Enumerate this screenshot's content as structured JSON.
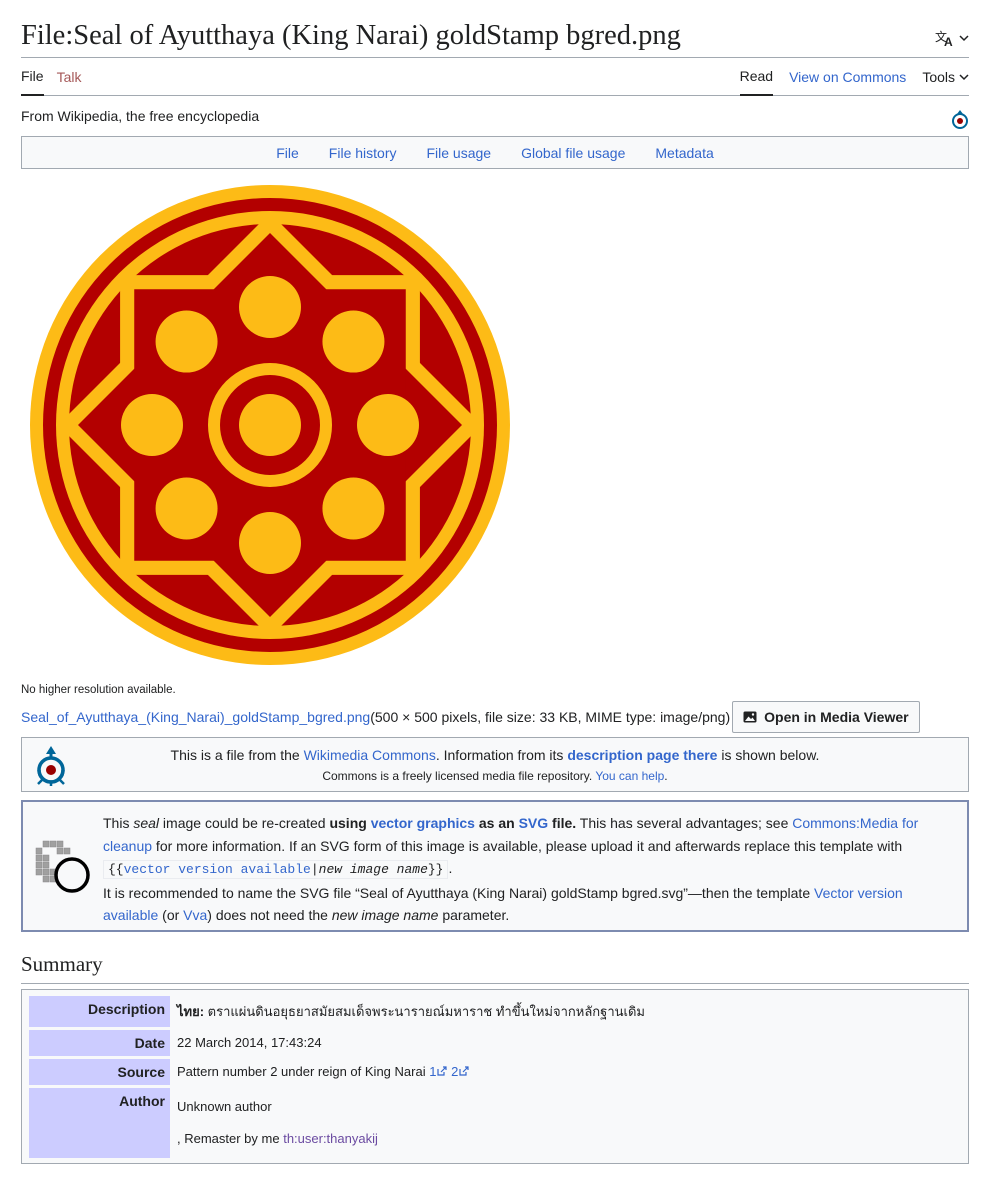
{
  "header": {
    "title": "File:Seal of Ayutthaya (King Narai) goldStamp bgred.png",
    "language_icon": "translate-icon"
  },
  "tabs": {
    "file": "File",
    "talk": "Talk",
    "read": "Read",
    "view_on_commons": "View on Commons",
    "tools": "Tools"
  },
  "tagline": "From Wikipedia, the free encyclopedia",
  "file_toc": [
    "File",
    "File history",
    "File usage",
    "Global file usage",
    "Metadata"
  ],
  "image": {
    "colors": {
      "gold": "#fdbb16",
      "red": "#b30000"
    },
    "no_higher": "No higher resolution available.",
    "file_link": "Seal_of_Ayutthaya_(King_Narai)_goldStamp_bgred.png",
    "file_meta": " (500 × 500 pixels, file size: 33 KB, MIME type: image/png)",
    "media_viewer_button": "Open in Media Viewer"
  },
  "commons_notice": {
    "text1": "This is a file from the ",
    "link1": "Wikimedia Commons",
    "text2": ". Information from its ",
    "link2": "description page there",
    "text3": " is shown below.",
    "line2_text": "Commons is a freely licensed media file repository. ",
    "line2_link": "You can help"
  },
  "vector_notice": {
    "p1": "This ",
    "p1_em": "seal",
    "p2": " image could be re-created ",
    "p2_bold": "using",
    "link_vector": "vector graphics",
    "p3_bold": " as an ",
    "link_svg": "SVG",
    "p4_bold": " file.",
    "p5": " This has several advantages; see ",
    "link_cleanup": "Commons:Media for cleanup",
    "p6": " for more information. If an SVG form of this image is available, please upload it and afterwards replace this template with ",
    "code_open": "{{",
    "code_link": "vector version available",
    "code_pipe": "|",
    "code_em": "new image name",
    "code_close": "}}",
    "p7": ".",
    "p8": "It is recommended to name the SVG file “Seal of Ayutthaya (King Narai) goldStamp bgred.svg”—then the template ",
    "link_vv": "Vector version available",
    "p9": " (or ",
    "link_vva": "Vva",
    "p10": ") does not need the ",
    "p10_em": "new image name",
    "p11": " parameter."
  },
  "summary": {
    "heading": "Summary",
    "rows": {
      "description_label": "Description",
      "description_lang": "ไทย:",
      "description_value": " ตราแผ่นดินอยุธยาสมัยสมเด็จพระนารายณ์มหาราช ทำขึ้นใหม่จากหลักฐานเดิม",
      "date_label": "Date",
      "date_value": "22 March 2014, 17:43:24",
      "source_label": "Source",
      "source_value": "Pattern number 2 under reign of King Narai ",
      "source_link1": "1",
      "source_link2": "2",
      "author_label": "Author",
      "author_value1": "Unknown author",
      "author_value2": ", Remaster by me ",
      "author_link": "th:user:thanyakij"
    }
  }
}
